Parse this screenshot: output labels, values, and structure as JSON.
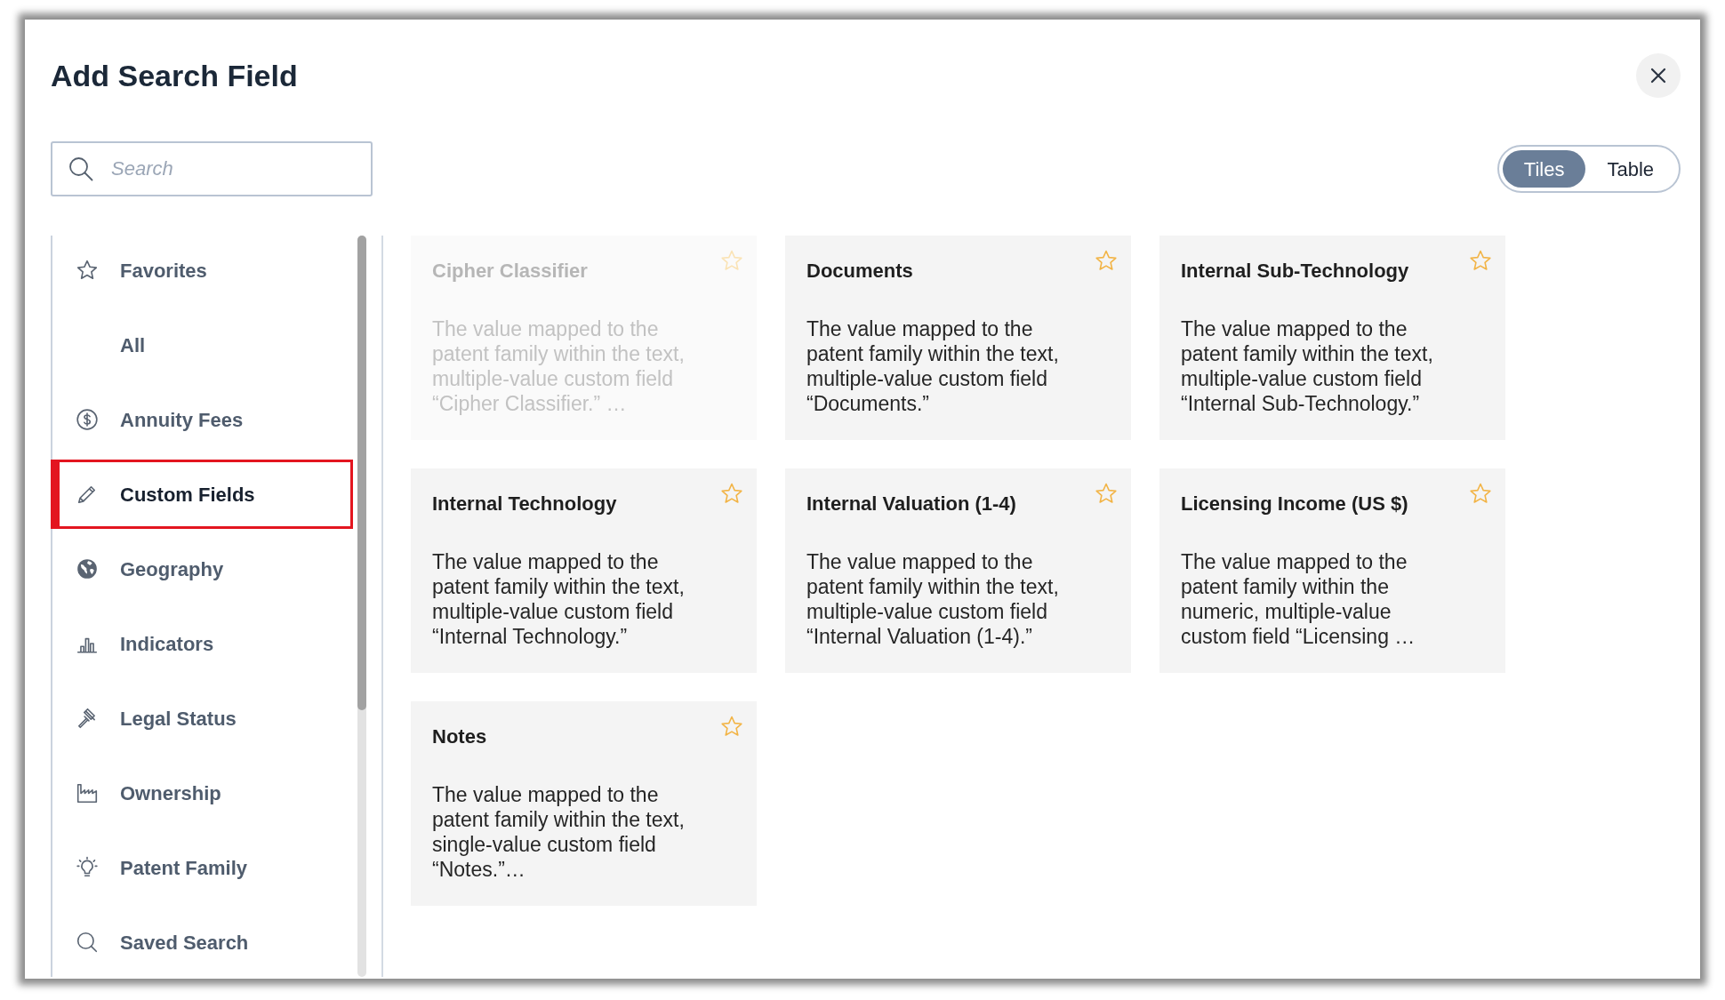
{
  "dialog": {
    "title": "Add Search Field"
  },
  "search": {
    "placeholder": "Search"
  },
  "view_toggle": [
    {
      "label": "Tiles",
      "selected": true
    },
    {
      "label": "Table",
      "selected": false
    }
  ],
  "sidebar": {
    "items": [
      {
        "label": "Favorites",
        "kind": "favorites",
        "selected": false
      },
      {
        "label": "All",
        "kind": "all",
        "selected": false
      },
      {
        "label": "Annuity Fees",
        "kind": "fees",
        "selected": false
      },
      {
        "label": "Custom Fields",
        "kind": "custom",
        "selected": true
      },
      {
        "label": "Geography",
        "kind": "geography",
        "selected": false
      },
      {
        "label": "Indicators",
        "kind": "indicators",
        "selected": false
      },
      {
        "label": "Legal Status",
        "kind": "legal",
        "selected": false
      },
      {
        "label": "Ownership",
        "kind": "ownership",
        "selected": false
      },
      {
        "label": "Patent Family",
        "kind": "family",
        "selected": false
      },
      {
        "label": "Saved Search",
        "kind": "saved",
        "selected": false
      }
    ]
  },
  "tiles": [
    {
      "title": "Cipher Classifier",
      "description": "The value mapped to the patent family within the text, multiple-value custom field “Cipher Classifier.” …",
      "disabled": true,
      "favorite": false
    },
    {
      "title": "Documents",
      "description": "The value mapped to the patent family within the text, multiple-value custom field “Documents.”",
      "disabled": false,
      "favorite": false
    },
    {
      "title": "Internal Sub-Technology",
      "description": "The value mapped to the patent family within the text, multiple-value custom field “Internal Sub-Technology.”",
      "disabled": false,
      "favorite": false
    },
    {
      "title": "Internal Technology",
      "description": "The value mapped to the patent family within the text, multiple-value custom field “Internal Technology.”",
      "disabled": false,
      "favorite": false
    },
    {
      "title": "Internal Valuation (1-4)",
      "description": "The value mapped to the patent family within the text, multiple-value custom field “Internal Valuation (1-4).”",
      "disabled": false,
      "favorite": false
    },
    {
      "title": "Licensing Income (US $)",
      "description": "The value mapped to the patent family within the numeric, multiple-value custom field “Licensing …",
      "disabled": false,
      "favorite": false
    },
    {
      "title": "Notes",
      "description": "The value mapped to the patent family within the text, single-value custom field “Notes.”…",
      "disabled": false,
      "favorite": false
    }
  ]
}
